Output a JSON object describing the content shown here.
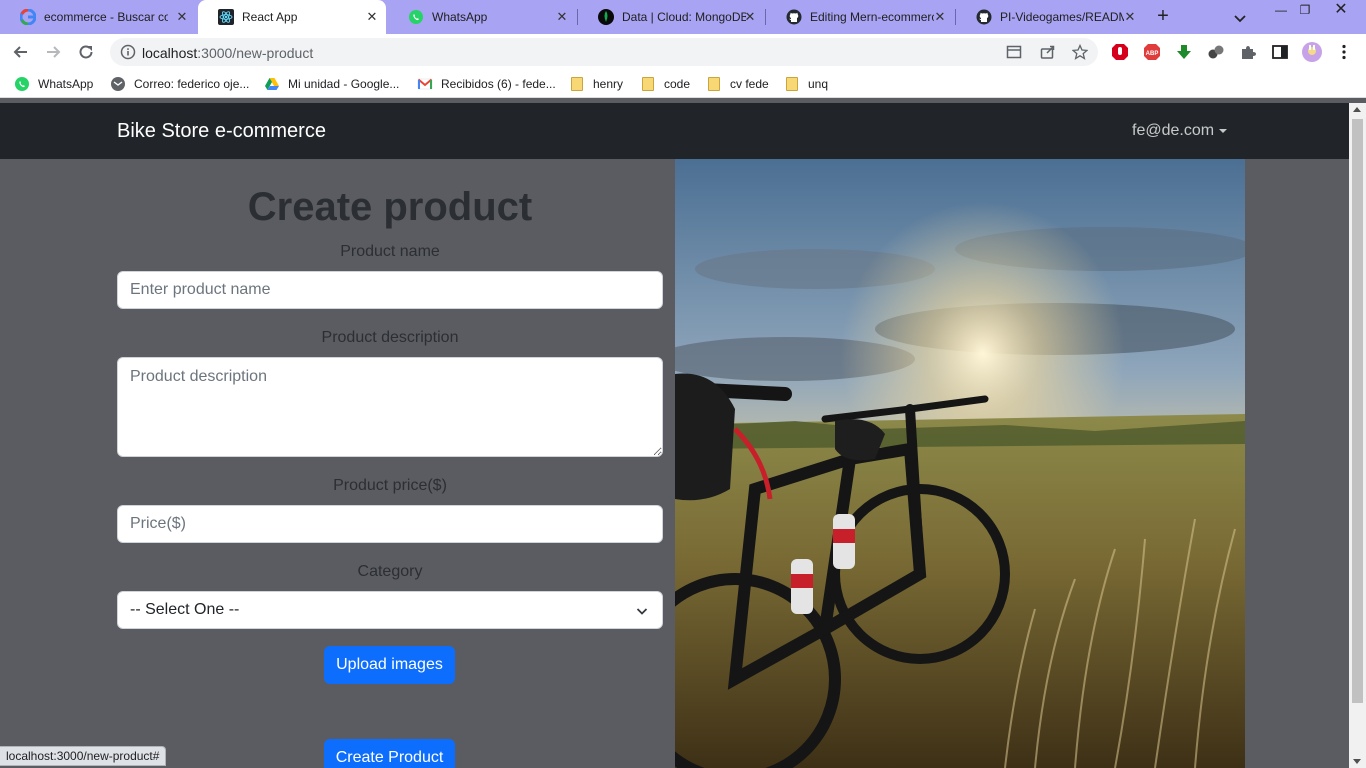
{
  "browser": {
    "tabs": [
      {
        "title": "ecommerce - Buscar con Google",
        "icon": "google-icon",
        "active": false
      },
      {
        "title": "React App",
        "icon": "react-icon",
        "active": true
      },
      {
        "title": "WhatsApp",
        "icon": "whatsapp-icon",
        "active": false
      },
      {
        "title": "Data | Cloud: MongoDB Cloud",
        "icon": "mongodb-icon",
        "active": false
      },
      {
        "title": "Editing Mern-ecommerce",
        "icon": "github-icon",
        "active": false
      },
      {
        "title": "PI-Videogames/README.md",
        "icon": "github-icon",
        "active": false
      }
    ],
    "url_host": "localhost",
    "url_path": ":3000/new-product",
    "bookmarks": [
      {
        "label": "WhatsApp",
        "icon": "whatsapp-icon"
      },
      {
        "label": "Correo: federico oje...",
        "icon": "mail-icon"
      },
      {
        "label": "Mi unidad - Google...",
        "icon": "drive-icon"
      },
      {
        "label": "Recibidos (6) - fede...",
        "icon": "gmail-icon"
      },
      {
        "label": "henry",
        "icon": "folder-icon"
      },
      {
        "label": "code",
        "icon": "folder-icon"
      },
      {
        "label": "cv fede",
        "icon": "folder-icon"
      },
      {
        "label": "unq",
        "icon": "folder-icon"
      }
    ],
    "status_url": "localhost:3000/new-product#"
  },
  "navbar": {
    "brand": "Bike Store e-commerce",
    "user": "fe@de.com"
  },
  "form": {
    "title": "Create product",
    "name_label": "Product name",
    "name_placeholder": "Enter product name",
    "description_label": "Product description",
    "description_placeholder": "Product description",
    "price_label": "Product price($)",
    "price_placeholder": "Price($)",
    "category_label": "Category",
    "category_selected": "-- Select One --",
    "upload_button": "Upload images",
    "create_button": "Create Product"
  },
  "colors": {
    "navbar": "#212529",
    "page_bg": "#5a5c61",
    "primary": "#0d6efd",
    "tabbar": "#a8a3f2"
  }
}
